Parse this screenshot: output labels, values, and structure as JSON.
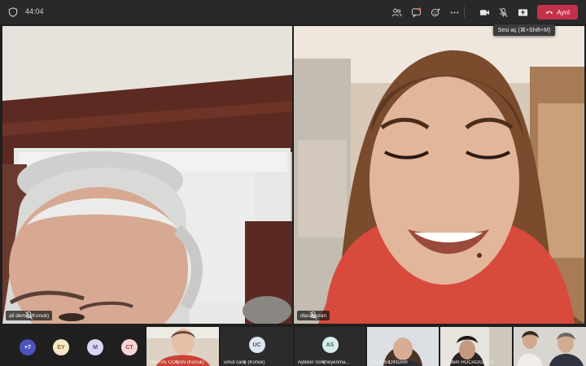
{
  "meeting": {
    "timer": "44:04",
    "leave_label": "Ayrıl",
    "tooltip": "Sesi aç (⌘+Shift+M)",
    "toolbar_icons": [
      "participants-icon",
      "chat-icon",
      "reactions-icon",
      "more-icon",
      "camera-icon",
      "mic-off-icon",
      "share-icon"
    ]
  },
  "videos": [
    {
      "name": "ali demir (Konuk)"
    },
    {
      "name": "dlarabozan"
    }
  ],
  "strip": {
    "overflow": {
      "label": "+7",
      "color": "#4b53bc"
    },
    "avatars": [
      {
        "initials": "EY",
        "bg": "#f3e6c9",
        "fg": "#8a6b1f"
      },
      {
        "initials": "M",
        "bg": "#d9d7f2",
        "fg": "#4b4a8a"
      },
      {
        "initials": "CT",
        "bg": "#f6d5d5",
        "fg": "#a33a3a"
      }
    ],
    "tiles": [
      {
        "name": "MERVE COBAN (Konuk)",
        "type": "video"
      },
      {
        "name": "umut canlı (Konuk)",
        "type": "avatar",
        "initials": "UC",
        "bg": "#dfe5ee",
        "fg": "#3c5473"
      },
      {
        "name": "Aytekin Sönmeyenma...",
        "type": "avatar",
        "initials": "AS",
        "bg": "#d9ecea",
        "fg": "#26736b"
      },
      {
        "name": "MERVE DINDAR",
        "type": "video"
      },
      {
        "name": "Meltem HOCAOĞLU A...",
        "type": "video"
      },
      {
        "name": "",
        "type": "video"
      }
    ]
  }
}
